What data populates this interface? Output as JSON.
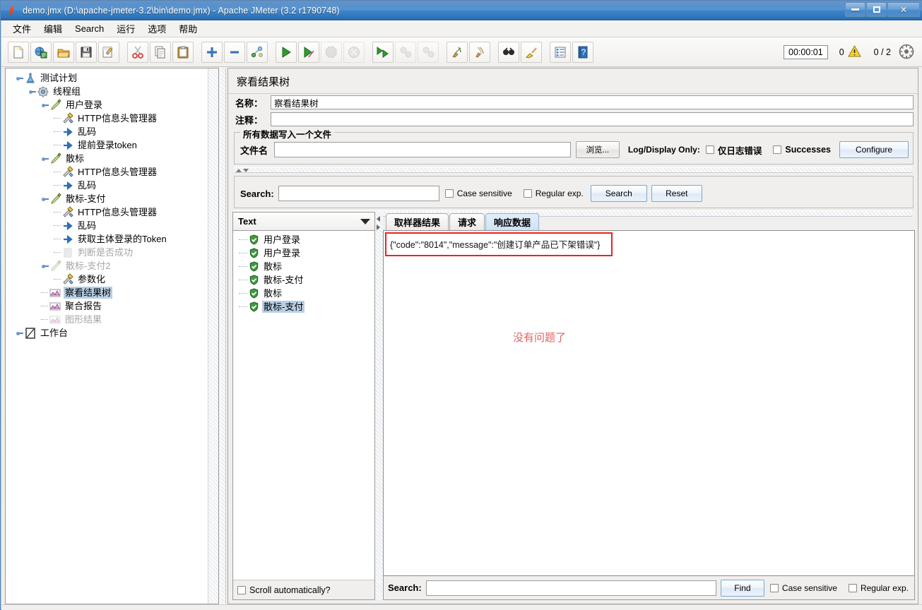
{
  "window": {
    "title": "demo.jmx (D:\\apache-jmeter-3.2\\bin\\demo.jmx) - Apache JMeter (3.2 r1790748)",
    "app_icon": "jmeter-feather-icon",
    "minimize_label": "–",
    "maximize_label": "□",
    "close_label": "✕"
  },
  "menubar": {
    "items": [
      {
        "label": "文件",
        "name": "menu-file"
      },
      {
        "label": "编辑",
        "name": "menu-edit"
      },
      {
        "label": "Search",
        "name": "menu-search"
      },
      {
        "label": "运行",
        "name": "menu-run"
      },
      {
        "label": "选项",
        "name": "menu-options"
      },
      {
        "label": "帮助",
        "name": "menu-help"
      }
    ]
  },
  "toolbar": {
    "buttons": [
      {
        "name": "new-icon",
        "tip": "New"
      },
      {
        "name": "templates-icon",
        "tip": "Templates"
      },
      {
        "name": "open-icon",
        "tip": "Open"
      },
      {
        "name": "save-icon",
        "tip": "Save"
      },
      {
        "name": "save-as-icon",
        "tip": "Save As"
      },
      {
        "name": "cut-icon",
        "tip": "Cut"
      },
      {
        "name": "copy-icon",
        "tip": "Copy"
      },
      {
        "name": "paste-icon",
        "tip": "Paste"
      },
      {
        "name": "expand-all-icon",
        "tip": "Expand All"
      },
      {
        "name": "collapse-all-icon",
        "tip": "Collapse All"
      },
      {
        "name": "toggle-icon",
        "tip": "Toggle"
      },
      {
        "name": "start-icon",
        "tip": "Start"
      },
      {
        "name": "start-no-pause-icon",
        "tip": "Start no pauses"
      },
      {
        "name": "stop-icon",
        "tip": "Stop"
      },
      {
        "name": "shutdown-icon",
        "tip": "Shutdown"
      },
      {
        "name": "start-remote-all-icon",
        "tip": "Start remote all"
      },
      {
        "name": "stop-remote-all-icon",
        "tip": "Stop remote all"
      },
      {
        "name": "shutdown-remote-all-icon",
        "tip": "Shutdown remote all"
      },
      {
        "name": "clear-icon",
        "tip": "Clear"
      },
      {
        "name": "clear-all-icon",
        "tip": "Clear All"
      },
      {
        "name": "search-icon",
        "tip": "Search"
      },
      {
        "name": "search-reset-icon",
        "tip": "Reset Search"
      },
      {
        "name": "function-helper-icon",
        "tip": "Function Helper Dialog"
      },
      {
        "name": "help-icon",
        "tip": "Help"
      }
    ],
    "elapsed_time": "00:00:01",
    "error_count": "0",
    "warning_icon": "warning-triangle-icon",
    "thread_count": "0 / 2",
    "remote_icon": "remote-engines-icon"
  },
  "tree": {
    "nodes": [
      {
        "label": "测试计划",
        "depth": 0,
        "icon": "test-plan-icon",
        "expanded": true,
        "disabled": false,
        "selected": false
      },
      {
        "label": "线程组",
        "depth": 1,
        "icon": "thread-group-icon",
        "expanded": true,
        "disabled": false,
        "selected": false
      },
      {
        "label": "用户登录",
        "depth": 2,
        "icon": "http-sampler-icon",
        "expanded": true,
        "disabled": false,
        "selected": false
      },
      {
        "label": "HTTP信息头管理器",
        "depth": 3,
        "icon": "header-manager-icon",
        "expanded": false,
        "disabled": false,
        "selected": false
      },
      {
        "label": "乱码",
        "depth": 3,
        "icon": "post-processor-icon",
        "expanded": false,
        "disabled": false,
        "selected": false
      },
      {
        "label": "提前登录token",
        "depth": 3,
        "icon": "post-processor-icon",
        "expanded": false,
        "disabled": false,
        "selected": false
      },
      {
        "label": "散标",
        "depth": 2,
        "icon": "http-sampler-icon",
        "expanded": true,
        "disabled": false,
        "selected": false
      },
      {
        "label": "HTTP信息头管理器",
        "depth": 3,
        "icon": "header-manager-icon",
        "expanded": false,
        "disabled": false,
        "selected": false
      },
      {
        "label": "乱码",
        "depth": 3,
        "icon": "post-processor-icon",
        "expanded": false,
        "disabled": false,
        "selected": false
      },
      {
        "label": "散标-支付",
        "depth": 2,
        "icon": "http-sampler-icon",
        "expanded": true,
        "disabled": false,
        "selected": false
      },
      {
        "label": "HTTP信息头管理器",
        "depth": 3,
        "icon": "header-manager-icon",
        "expanded": false,
        "disabled": false,
        "selected": false
      },
      {
        "label": "乱码",
        "depth": 3,
        "icon": "post-processor-icon",
        "expanded": false,
        "disabled": false,
        "selected": false
      },
      {
        "label": "获取主体登录的Token",
        "depth": 3,
        "icon": "post-processor-icon",
        "expanded": false,
        "disabled": false,
        "selected": false
      },
      {
        "label": "判断是否成功",
        "depth": 3,
        "icon": "assertion-icon",
        "expanded": false,
        "disabled": true,
        "selected": false
      },
      {
        "label": "散标-支付2",
        "depth": 2,
        "icon": "http-sampler-icon",
        "expanded": true,
        "disabled": true,
        "selected": false
      },
      {
        "label": "参数化",
        "depth": 3,
        "icon": "header-manager-icon",
        "expanded": false,
        "disabled": false,
        "selected": false
      },
      {
        "label": "察看结果树",
        "depth": 2,
        "icon": "listener-icon",
        "expanded": false,
        "disabled": false,
        "selected": true
      },
      {
        "label": "聚合报告",
        "depth": 2,
        "icon": "listener-icon",
        "expanded": false,
        "disabled": false,
        "selected": false
      },
      {
        "label": "图形结果",
        "depth": 2,
        "icon": "listener-icon",
        "expanded": false,
        "disabled": true,
        "selected": false
      },
      {
        "label": "工作台",
        "depth": 0,
        "icon": "workbench-icon",
        "expanded": true,
        "disabled": false,
        "selected": false
      }
    ]
  },
  "panel": {
    "title": "察看结果树",
    "name_label": "名称：",
    "name_value": "察看结果树",
    "comment_label": "注释：",
    "comment_value": "",
    "file_group_title": "所有数据写入一个文件",
    "filename_label": "文件名",
    "filename_value": "",
    "browse_label": "浏览...",
    "log_display_label": "Log/Display Only:",
    "errors_only_label": "仅日志错误",
    "errors_only_checked": false,
    "successes_label": "Successes",
    "successes_checked": false,
    "configure_label": "Configure"
  },
  "search_panel": {
    "label": "Search:",
    "value": "",
    "case_sensitive_label": "Case sensitive",
    "case_sensitive_checked": false,
    "regex_label": "Regular exp.",
    "regex_checked": false,
    "search_button": "Search",
    "reset_button": "Reset"
  },
  "results": {
    "render_selector": "Text",
    "items": [
      {
        "label": "用户登录",
        "status": "success",
        "selected": false
      },
      {
        "label": "用户登录",
        "status": "success",
        "selected": false
      },
      {
        "label": "散标",
        "status": "success",
        "selected": false
      },
      {
        "label": "散标-支付",
        "status": "success",
        "selected": false
      },
      {
        "label": "散标",
        "status": "success",
        "selected": false
      },
      {
        "label": "散标-支付",
        "status": "success",
        "selected": true
      }
    ],
    "scroll_auto_label": "Scroll automatically?",
    "scroll_auto_checked": false
  },
  "detail": {
    "tabs": [
      {
        "label": "取样器结果",
        "active": false
      },
      {
        "label": "请求",
        "active": false
      },
      {
        "label": "响应数据",
        "active": true
      }
    ],
    "response_text": "{\"code\":\"8014\",\"message\":\"创建订单产品已下架错误\"}",
    "annotation_text": "没有问题了",
    "annotation_color": "#e0625f",
    "highlight_color": "#e8241f"
  },
  "find_bar": {
    "label": "Search:",
    "value": "",
    "find_button": "Find",
    "case_sensitive_label": "Case sensitive",
    "case_sensitive_checked": false,
    "regex_label": "Regular exp.",
    "regex_checked": false
  }
}
